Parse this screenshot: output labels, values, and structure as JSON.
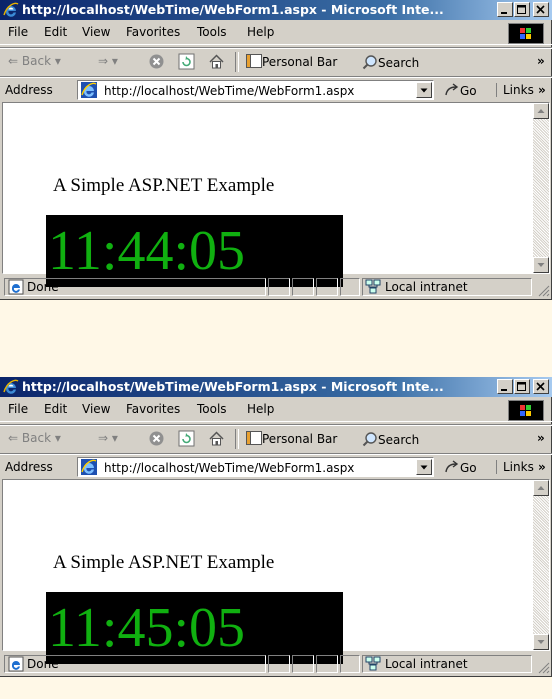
{
  "windows": [
    {
      "title": "http://localhost/WebTime/WebForm1.aspx - Microsoft Inte...",
      "menu": [
        "File",
        "Edit",
        "View",
        "Favorites",
        "Tools",
        "Help"
      ],
      "toolbar": {
        "back": "Back",
        "personal_bar": "Personal Bar",
        "search": "Search"
      },
      "address": {
        "label": "Address",
        "url": "http://localhost/WebTime/WebForm1.aspx",
        "go": "Go",
        "links": "Links"
      },
      "page": {
        "heading": "A Simple ASP.NET Example",
        "time": "11:44:05"
      },
      "status": {
        "text": "Done",
        "zone": "Local intranet"
      }
    },
    {
      "title": "http://localhost/WebTime/WebForm1.aspx - Microsoft Inte...",
      "menu": [
        "File",
        "Edit",
        "View",
        "Favorites",
        "Tools",
        "Help"
      ],
      "toolbar": {
        "back": "Back",
        "personal_bar": "Personal Bar",
        "search": "Search"
      },
      "address": {
        "label": "Address",
        "url": "http://localhost/WebTime/WebForm1.aspx",
        "go": "Go",
        "links": "Links"
      },
      "page": {
        "heading": "A Simple ASP.NET Example",
        "time": "11:45:05"
      },
      "status": {
        "text": "Done",
        "zone": "Local intranet"
      }
    }
  ],
  "colors": {
    "title_start": "#0a246a",
    "title_end": "#a6caf0",
    "clock_bg": "#000000",
    "clock_text": "#10b010",
    "chrome": "#d4d0c8",
    "backdrop": "#fff8e7"
  }
}
